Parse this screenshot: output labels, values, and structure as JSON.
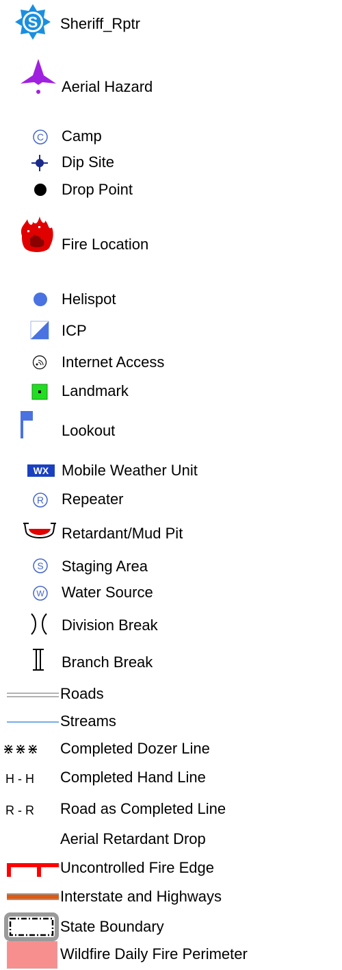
{
  "legend": {
    "items": [
      {
        "label": "Sheriff_Rptr",
        "icon": "sheriff-star-icon",
        "color": "#1a8fe0"
      },
      {
        "label": "Aerial Hazard",
        "icon": "aerial-hazard-icon",
        "color": "#a020e0"
      },
      {
        "label": "Camp",
        "icon": "circled-c-icon",
        "letter": "C",
        "color": "#4466cc"
      },
      {
        "label": "Dip Site",
        "icon": "crosshair-dot-icon",
        "color": "#1a2a8a"
      },
      {
        "label": "Drop Point",
        "icon": "black-dot-icon",
        "color": "#000000"
      },
      {
        "label": "Fire Location",
        "icon": "flame-icon",
        "color": "#e00000"
      },
      {
        "label": "Helispot",
        "icon": "blue-dot-icon",
        "color": "#4a72e0"
      },
      {
        "label": "ICP",
        "icon": "icp-triangle-icon",
        "color": "#4a72e0"
      },
      {
        "label": "Internet Access",
        "icon": "wifi-circle-icon",
        "color": "#000000"
      },
      {
        "label": "Landmark",
        "icon": "green-square-icon",
        "color": "#22dd22"
      },
      {
        "label": "Lookout",
        "icon": "flag-icon",
        "color": "#4a72e0"
      },
      {
        "label": "Mobile Weather Unit",
        "icon": "wx-badge-icon",
        "badge": "WX",
        "color": "#1a40c0"
      },
      {
        "label": "Repeater",
        "icon": "circled-r-icon",
        "letter": "R",
        "color": "#4466cc"
      },
      {
        "label": "Retardant/Mud Pit",
        "icon": "mud-pit-icon",
        "color": "#e00000"
      },
      {
        "label": "Staging Area",
        "icon": "circled-s-icon",
        "letter": "S",
        "color": "#4466cc"
      },
      {
        "label": "Water Source",
        "icon": "circled-w-icon",
        "letter": "W",
        "color": "#4466cc"
      },
      {
        "label": "Division Break",
        "icon": "division-break-icon",
        "glyph": ")(",
        "color": "#000000"
      },
      {
        "label": "Branch Break",
        "icon": "branch-break-icon",
        "glyph": "][",
        "color": "#000000"
      }
    ],
    "lines": [
      {
        "label": "Roads",
        "icon": "double-line-icon",
        "color": "#999999"
      },
      {
        "label": "Streams",
        "icon": "stream-line-icon",
        "color": "#4a90e2"
      },
      {
        "label": "Completed Dozer Line",
        "icon": "dozer-line-icon",
        "glyph": "⋇⋇⋇",
        "color": "#000000"
      },
      {
        "label": "Completed Hand Line",
        "icon": "hand-line-icon",
        "glyph": "H - H",
        "color": "#000000"
      },
      {
        "label": "Road as Completed Line",
        "icon": "road-line-icon",
        "glyph": "R - R",
        "color": "#000000"
      },
      {
        "label": "Aerial Retardant Drop",
        "icon": "none",
        "color": "#ffffff"
      },
      {
        "label": "Uncontrolled Fire Edge",
        "icon": "uncontrolled-edge-icon",
        "color": "#ff0000"
      },
      {
        "label": "Interstate and Highways",
        "icon": "highway-line-icon",
        "color": "#e05a10"
      },
      {
        "label": "State Boundary",
        "icon": "state-boundary-icon",
        "color": "#999999"
      },
      {
        "label": "Wildfire Daily Fire Perimeter",
        "icon": "perimeter-swatch-icon",
        "color": "#f88f8f"
      }
    ]
  }
}
